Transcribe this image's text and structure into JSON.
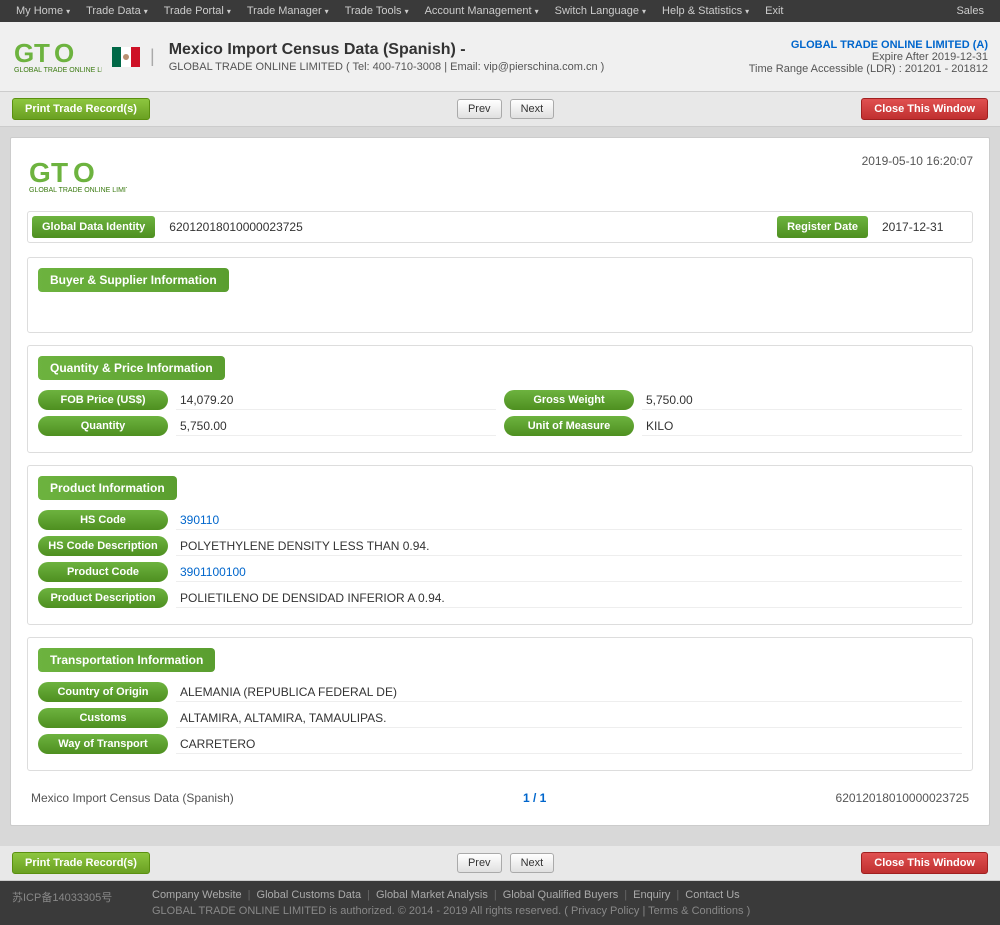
{
  "nav": {
    "items": [
      {
        "label": "My Home",
        "has_arrow": true
      },
      {
        "label": "Trade Data",
        "has_arrow": true
      },
      {
        "label": "Trade Portal",
        "has_arrow": true
      },
      {
        "label": "Trade Manager",
        "has_arrow": true
      },
      {
        "label": "Trade Tools",
        "has_arrow": true
      },
      {
        "label": "Account Management",
        "has_arrow": true
      },
      {
        "label": "Switch Language",
        "has_arrow": true
      },
      {
        "label": "Help & Statistics",
        "has_arrow": true
      },
      {
        "label": "Exit",
        "has_arrow": false
      }
    ],
    "right_label": "Sales"
  },
  "header": {
    "page_title": "Mexico Import Census Data (Spanish)  -",
    "subtitle": "GLOBAL TRADE ONLINE LIMITED ( Tel: 400-710-3008 | Email: vip@pierschina.com.cn )",
    "account_name": "GLOBAL TRADE ONLINE LIMITED (A)",
    "expire": "Expire After 2019-12-31",
    "ldr": "Time Range Accessible (LDR) : 201201 - 201812"
  },
  "toolbar": {
    "print_label": "Print Trade Record(s)",
    "prev_label": "Prev",
    "next_label": "Next",
    "close_label": "Close This Window"
  },
  "record": {
    "date": "2019-05-10 16:20:07",
    "global_data_identity_label": "Global Data Identity",
    "global_data_identity_value": "62012018010000023725",
    "register_date_label": "Register Date",
    "register_date_value": "2017-12-31",
    "sections": {
      "buyer_supplier": {
        "title": "Buyer & Supplier Information"
      },
      "quantity_price": {
        "title": "Quantity & Price Information",
        "fields": [
          {
            "label": "FOB Price (US$)",
            "value": "14,079.20",
            "col": 0
          },
          {
            "label": "Gross Weight",
            "value": "5,750.00",
            "col": 1
          },
          {
            "label": "Quantity",
            "value": "5,750.00",
            "col": 0
          },
          {
            "label": "Unit of Measure",
            "value": "KILO",
            "col": 1
          }
        ]
      },
      "product": {
        "title": "Product Information",
        "fields": [
          {
            "label": "HS Code",
            "value": "390110",
            "is_hs": true
          },
          {
            "label": "HS Code Description",
            "value": "POLYETHYLENE DENSITY LESS THAN 0.94."
          },
          {
            "label": "Product Code",
            "value": "3901100100",
            "is_hs": true
          },
          {
            "label": "Product Description",
            "value": "POLIETILENO DE DENSIDAD INFERIOR A 0.94."
          }
        ]
      },
      "transportation": {
        "title": "Transportation Information",
        "fields": [
          {
            "label": "Country of Origin",
            "value": "ALEMANIA (REPUBLICA FEDERAL DE)"
          },
          {
            "label": "Customs",
            "value": "ALTAMIRA, ALTAMIRA, TAMAULIPAS."
          },
          {
            "label": "Way of Transport",
            "value": "CARRETERO"
          }
        ]
      }
    },
    "footer": {
      "left": "Mexico Import Census Data (Spanish)",
      "center": "1 / 1",
      "right": "62012018010000023725"
    }
  },
  "page_footer": {
    "links": [
      "Company Website",
      "Global Customs Data",
      "Global Market Analysis",
      "Global Qualified Buyers",
      "Enquiry",
      "Contact Us"
    ],
    "copyright": "GLOBAL TRADE ONLINE LIMITED is authorized. © 2014 - 2019 All rights reserved.  (  Privacy Policy  |  Terms & Conditions  )",
    "icp": "苏ICP备14033305号"
  }
}
